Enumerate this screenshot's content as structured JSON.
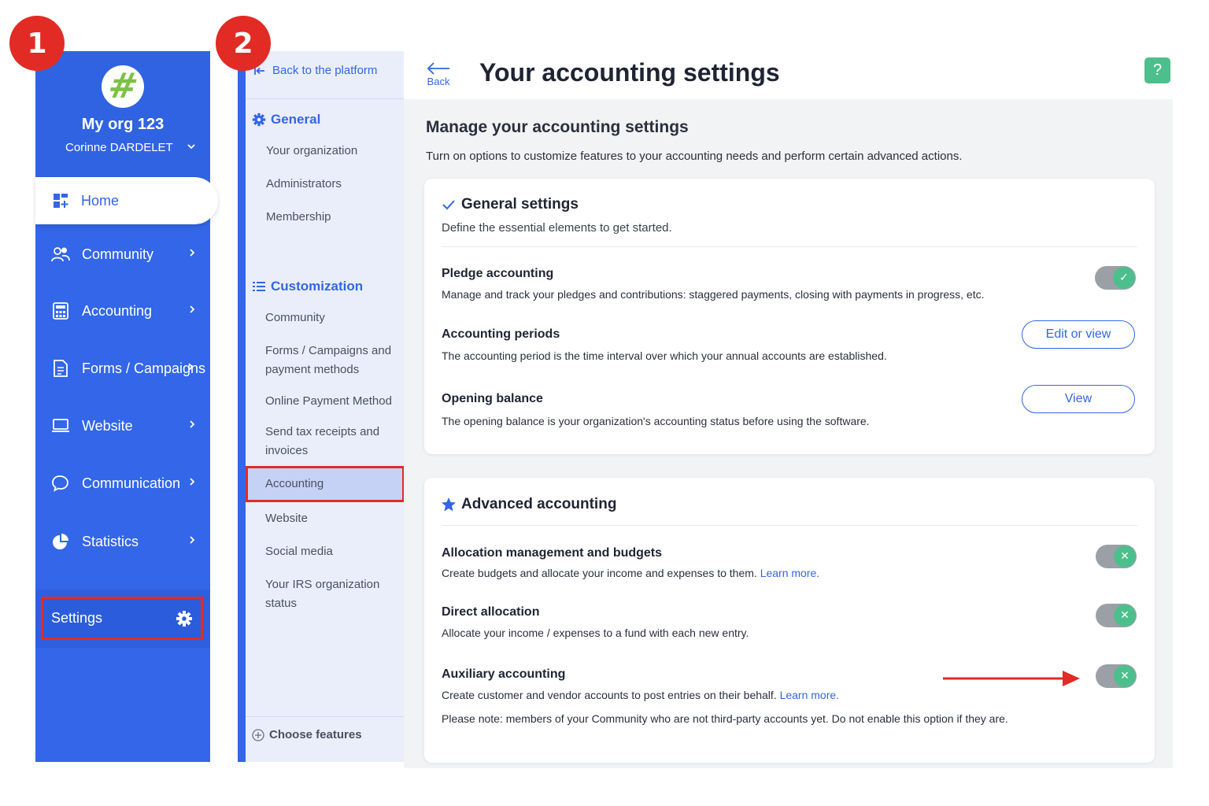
{
  "badges": {
    "step1": "1",
    "step2": "2"
  },
  "sidebar": {
    "org_name": "My org 123",
    "user_name": "Corinne DARDELET",
    "items": [
      {
        "label": "Home"
      },
      {
        "label": "Community"
      },
      {
        "label": "Accounting"
      },
      {
        "label": "Forms / Campaigns"
      },
      {
        "label": "Website"
      },
      {
        "label": "Communication"
      },
      {
        "label": "Statistics"
      }
    ],
    "settings_label": "Settings"
  },
  "subnav": {
    "back_label": "Back to the platform",
    "general_heading": "General",
    "general_items": [
      "Your organization",
      "Administrators",
      "Membership"
    ],
    "custom_heading": "Customization",
    "custom_items": [
      "Community",
      "Forms / Campaigns and payment methods",
      "Online Payment Method",
      "Send tax receipts and invoices",
      "Accounting",
      "Website",
      "Social media",
      "Your IRS organization status"
    ],
    "choose_label": "Choose features"
  },
  "header": {
    "back_label": "Back",
    "title": "Your accounting settings",
    "help_label": "?"
  },
  "main": {
    "title": "Manage your accounting settings",
    "subtitle": "Turn on options to customize features to your accounting needs and perform certain advanced actions."
  },
  "general_card": {
    "title": "General settings",
    "subtitle": "Define the essential elements to get started.",
    "rows": [
      {
        "title": "Pledge accounting",
        "desc": "Manage and track your pledges and contributions: staggered payments, closing with payments in progress, etc."
      },
      {
        "title": "Accounting periods",
        "desc": "The accounting period is the time interval over which your annual accounts are established.",
        "button": "Edit or view"
      },
      {
        "title": "Opening balance",
        "desc": "The opening balance is your organization's accounting status before using the software.",
        "button": "View"
      }
    ]
  },
  "advanced_card": {
    "title": "Advanced accounting",
    "rows": [
      {
        "title": "Allocation management and budgets",
        "desc": "Create budgets and allocate your income and expenses to them.",
        "link": "Learn more."
      },
      {
        "title": "Direct allocation",
        "desc": "Allocate your income / expenses to a fund with each new entry."
      },
      {
        "title": "Auxiliary accounting",
        "desc": "Create customer and vendor accounts to post entries on their behalf.",
        "link": "Learn more.",
        "note": "Please note: members of your Community who are not third-party accounts yet. Do not enable this option if they are."
      }
    ]
  },
  "colors": {
    "brand_blue": "#3366e8",
    "highlight_red": "#e22b25",
    "toggle_green": "#4dbf8c"
  },
  "icons": {
    "check": "✓",
    "cross": "✕"
  }
}
